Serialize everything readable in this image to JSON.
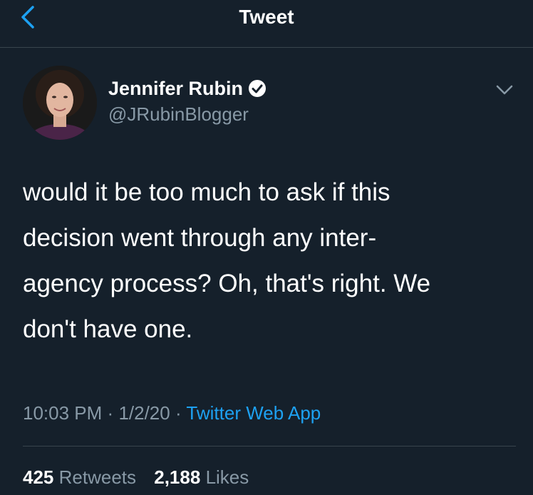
{
  "header": {
    "title": "Tweet",
    "back_icon": "chevron-left-icon"
  },
  "author": {
    "name": "Jennifer Rubin",
    "handle": "@JRubinBlogger",
    "verified": true
  },
  "tweet": {
    "text": "would it be too much to ask if this\ndecision went through any inter-\nagency process? Oh, that's right. We\ndon't have one.",
    "time": "10:03 PM",
    "separator1": "·",
    "date": "1/2/20",
    "separator2": "·",
    "source": "Twitter Web App"
  },
  "stats": {
    "retweets_count": "425",
    "retweets_label": "Retweets",
    "likes_count": "2,188",
    "likes_label": "Likes"
  },
  "colors": {
    "background": "#15202b",
    "accent": "#1da1f2",
    "secondary_text": "#8899a6",
    "divider": "#38444d"
  }
}
